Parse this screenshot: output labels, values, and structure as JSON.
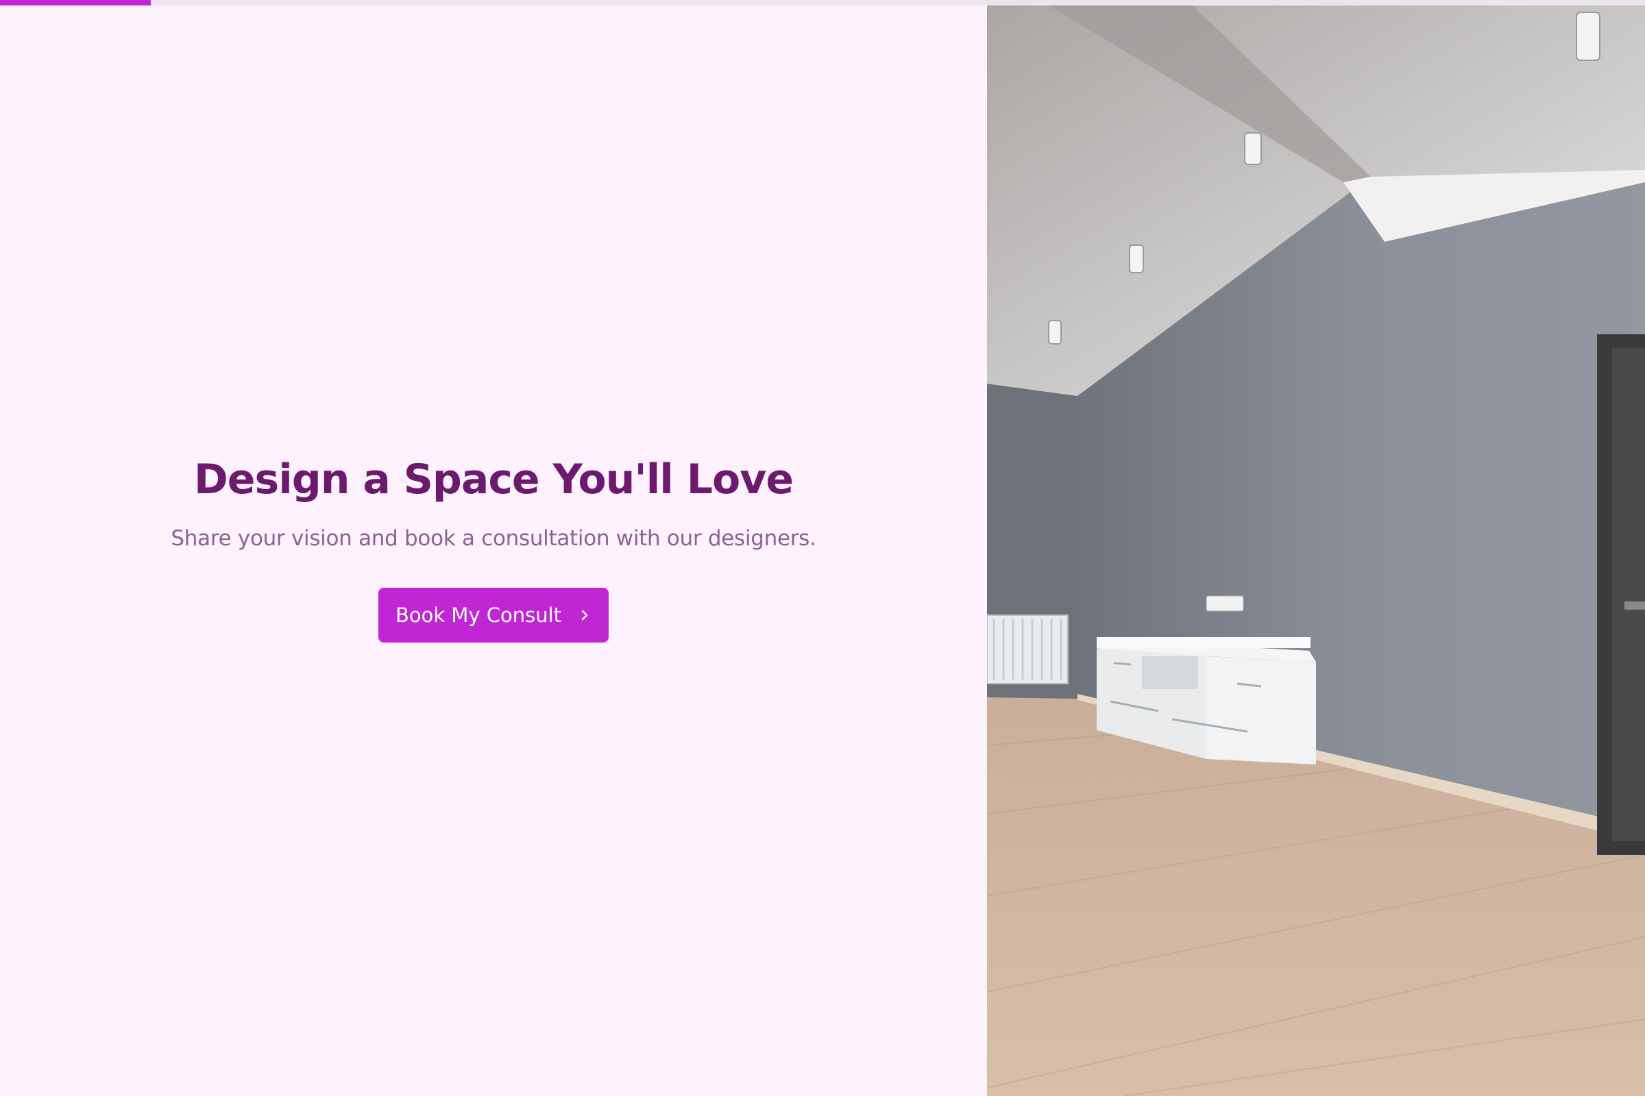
{
  "progress": {
    "fraction": 0.0917
  },
  "hero": {
    "title": "Design a Space You'll Love",
    "subtitle": "Share your vision and book a consultation with our designers.",
    "cta_label": "Book My Consult",
    "cta_icon": "chevron-right-icon"
  },
  "image": {
    "description_icon": "room-photo",
    "subject": "empty interior room with white cabinet"
  },
  "colors": {
    "accent": "#c026d3",
    "title": "#6b1a6e",
    "subtitle": "#8c6292",
    "background": "#fdf2fd"
  }
}
